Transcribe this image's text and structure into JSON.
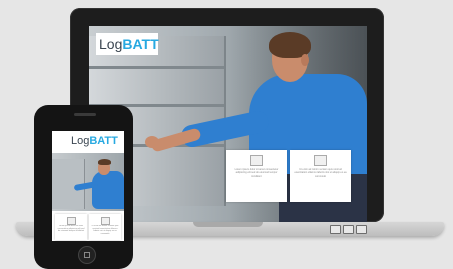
{
  "brand": {
    "logo_prefix": "Log",
    "logo_accent": "BATT"
  },
  "cards": [
    {
      "icon": "box-icon",
      "text": "Lorem ipsum dolor sit amet consectetur adipiscing elit sed do eiusmod tempor incididunt"
    },
    {
      "icon": "chart-icon",
      "text": "Ut enim ad minim veniam quis nostrud exercitation ullamco laboris nisi ut aliquip ex ea commodo"
    }
  ],
  "colors": {
    "accent": "#27a9e1",
    "shirt": "#2f7fd0",
    "device": "#1d1d1d"
  }
}
